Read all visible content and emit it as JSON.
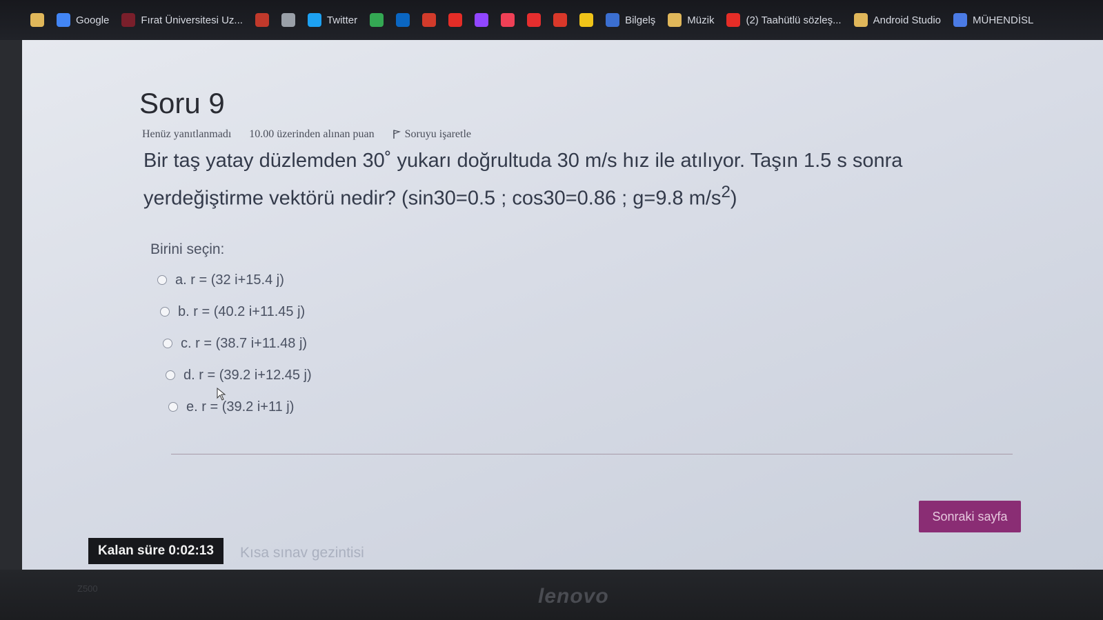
{
  "bookmarks": [
    {
      "label": "",
      "icon": "folder-icon",
      "color": "#e0b75a"
    },
    {
      "label": "Google",
      "icon": "google-icon",
      "color": "#4285f4"
    },
    {
      "label": "Fırat Üniversitesi Uz...",
      "icon": "university-icon",
      "color": "#7a1f2b"
    },
    {
      "label": "",
      "icon": "pin-icon",
      "color": "#c0392b"
    },
    {
      "label": "",
      "icon": "globe-icon",
      "color": "#9aa0a8"
    },
    {
      "label": "Twitter",
      "icon": "twitter-icon",
      "color": "#1da1f2"
    },
    {
      "label": "",
      "icon": "drive-icon",
      "color": "#34a853"
    },
    {
      "label": "",
      "icon": "linkedin-icon",
      "color": "#0a66c2"
    },
    {
      "label": "",
      "icon": "udemy-icon",
      "color": "#d23b2b"
    },
    {
      "label": "",
      "icon": "youtube-icon",
      "color": "#e52d27"
    },
    {
      "label": "",
      "icon": "twitch-icon",
      "color": "#9146ff"
    },
    {
      "label": "",
      "icon": "pocket-icon",
      "color": "#ef4056"
    },
    {
      "label": "",
      "icon": "hb-icon",
      "color": "#e62e2e"
    },
    {
      "label": "",
      "icon": "refresh-red-icon",
      "color": "#d9382a"
    },
    {
      "label": "",
      "icon": "s-icon",
      "color": "#f0c419"
    },
    {
      "label": "Bilgelş",
      "icon": "bilgeis-icon",
      "color": "#3b6fd1"
    },
    {
      "label": "Müzik",
      "icon": "folder-icon",
      "color": "#e0b75a"
    },
    {
      "label": "(2) Taahütlü sözleş...",
      "icon": "youtube-icon",
      "color": "#e52d27"
    },
    {
      "label": "Android Studio",
      "icon": "folder-icon",
      "color": "#e0b75a"
    },
    {
      "label": "MÜHENDİSL",
      "icon": "app-icon",
      "color": "#4b7be5"
    }
  ],
  "question": {
    "title": "Soru 9",
    "status": "Henüz yanıtlanmadı",
    "points": "10.00 üzerinden alınan puan",
    "flag_label": "Soruyu işaretle",
    "text_line1": "Bir taş yatay düzlemden 30˚ yukarı doğrultuda 30 m/s hız ile atılıyor. Taşın 1.5 s sonra",
    "text_line2": "yerdeğiştirme vektörü nedir? (sin30=0.5 ; cos30=0.86 ;  g=9.8 m/s",
    "text_sup": "2",
    "text_end": ")"
  },
  "choose_label": "Birini seçin:",
  "options": [
    {
      "label": "a. r = (32 i+15.4 j)"
    },
    {
      "label": "b. r = (40.2 i+11.45 j)"
    },
    {
      "label": "c. r = (38.7 i+11.48 j)"
    },
    {
      "label": "d. r = (39.2 i+12.45 j)"
    },
    {
      "label": "e. r = (39.2 i+11 j)"
    }
  ],
  "next_button": "Sonraki sayfa",
  "timer": "Kalan süre 0:02:13",
  "quiz_nav": "Kısa sınav gezintisi",
  "hardware": {
    "brand": "lenovo",
    "model": "Z500"
  }
}
